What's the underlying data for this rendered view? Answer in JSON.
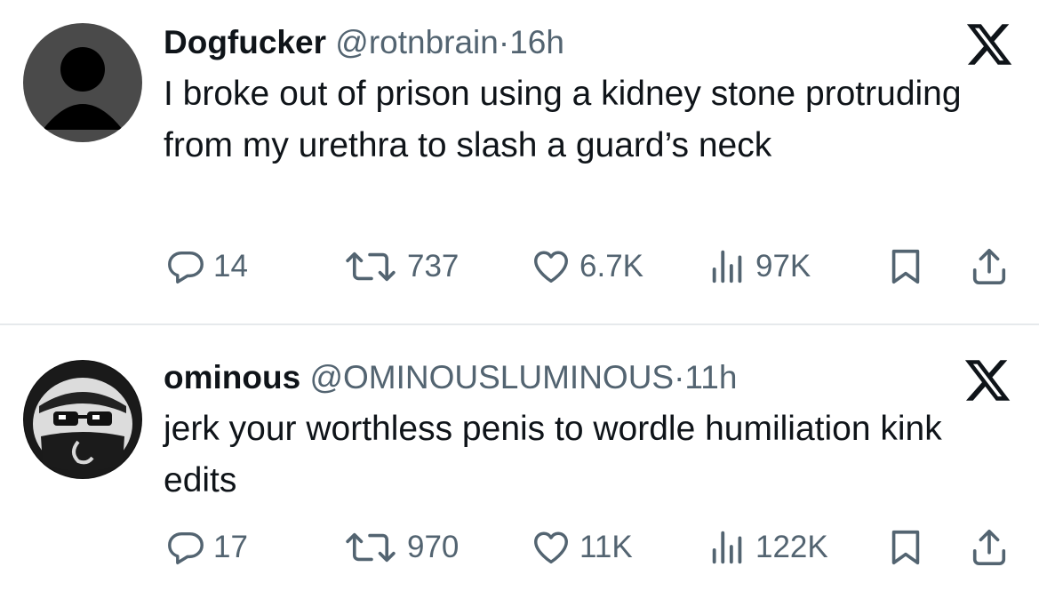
{
  "tweets": [
    {
      "name": "Dogfucker",
      "handle": "@rotnbrain",
      "separator": "·",
      "time": "16h",
      "text": "I broke out of prison using a kidney stone protruding from my urethra to slash a guard’s neck",
      "replies": "14",
      "reposts": "737",
      "likes": "6.7K",
      "views": "97K",
      "avatar_icon": "default-profile-icon"
    },
    {
      "name": "ominous",
      "handle": "@OMINOUSLUMINOUS",
      "separator": "·",
      "time": "11h",
      "text": "jerk your worthless penis to wordle humiliation kink edits",
      "replies": "17",
      "reposts": "970",
      "likes": "11K",
      "views": "122K",
      "avatar_icon": "masked-face-avatar"
    }
  ],
  "colors": {
    "text": "#0f1419",
    "secondary": "#536471",
    "divider": "#e6e9ec"
  }
}
